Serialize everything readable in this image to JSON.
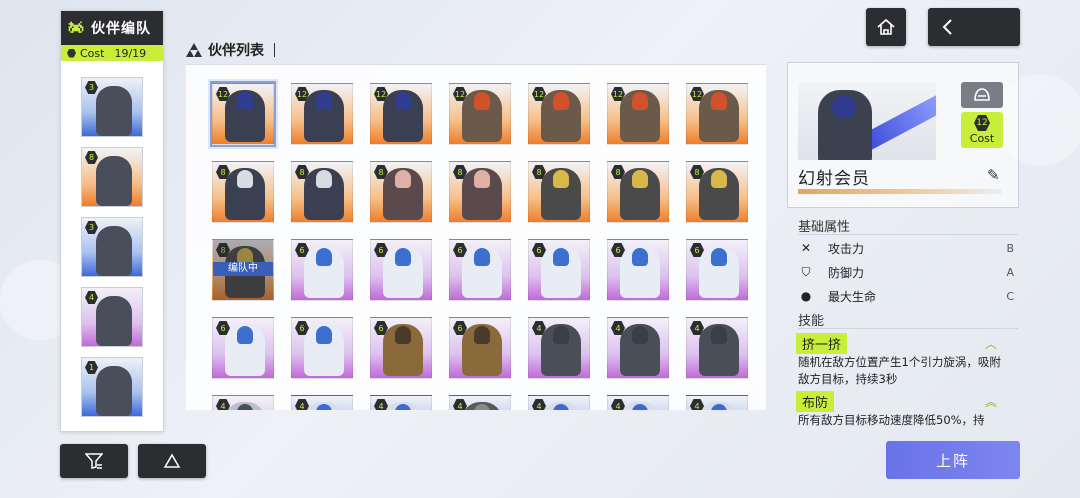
{
  "team": {
    "title": "伙伴编队",
    "cost_label": "Cost",
    "cost_value": "19/19",
    "members": [
      {
        "level": "3",
        "bg": "blue"
      },
      {
        "level": "8",
        "bg": "orange"
      },
      {
        "level": "3",
        "bg": "blue"
      },
      {
        "level": "4",
        "bg": "purple"
      },
      {
        "level": "1",
        "bg": "blue"
      }
    ]
  },
  "list": {
    "title": "伙伴列表",
    "cards": [
      {
        "level": "12",
        "bg": "orange",
        "tone": "#3b3f52",
        "head": "#2f3c8f",
        "selected": true
      },
      {
        "level": "12",
        "bg": "orange",
        "tone": "#3b3f52",
        "head": "#2f3c8f"
      },
      {
        "level": "12",
        "bg": "orange",
        "tone": "#3b3f52",
        "head": "#2f3c8f"
      },
      {
        "level": "12",
        "bg": "orange",
        "tone": "#6b5a4a",
        "head": "#d2502a"
      },
      {
        "level": "12",
        "bg": "orange",
        "tone": "#6b5a4a",
        "head": "#d2502a"
      },
      {
        "level": "12",
        "bg": "orange",
        "tone": "#6b5a4a",
        "head": "#d2502a"
      },
      {
        "level": "12",
        "bg": "orange",
        "tone": "#6b5a4a",
        "head": "#d2502a"
      },
      {
        "level": "8",
        "bg": "orange",
        "tone": "#3b3f52",
        "head": "#d9dbe2"
      },
      {
        "level": "8",
        "bg": "orange",
        "tone": "#3b3f52",
        "head": "#d9dbe2"
      },
      {
        "level": "8",
        "bg": "orange",
        "tone": "#5a4a4e",
        "head": "#e0b0a8"
      },
      {
        "level": "8",
        "bg": "orange",
        "tone": "#5a4a4e",
        "head": "#e0b0a8"
      },
      {
        "level": "8",
        "bg": "orange",
        "tone": "#4a4a4a",
        "head": "#d8b848"
      },
      {
        "level": "8",
        "bg": "orange",
        "tone": "#4a4a4a",
        "head": "#d8b848"
      },
      {
        "level": "8",
        "bg": "orange",
        "tone": "#4a4a4a",
        "head": "#d8b848"
      },
      {
        "level": "8",
        "bg": "orange",
        "tone": "#4a4a4a",
        "head": "#d8b848",
        "dim": true,
        "badge": "编队中"
      },
      {
        "level": "6",
        "bg": "purple",
        "tone": "#e8ecf4",
        "head": "#3c6fd0"
      },
      {
        "level": "6",
        "bg": "purple",
        "tone": "#e8ecf4",
        "head": "#3c6fd0"
      },
      {
        "level": "6",
        "bg": "purple",
        "tone": "#e8ecf4",
        "head": "#3c6fd0"
      },
      {
        "level": "6",
        "bg": "purple",
        "tone": "#e8ecf4",
        "head": "#3c6fd0"
      },
      {
        "level": "6",
        "bg": "purple",
        "tone": "#e8ecf4",
        "head": "#3c6fd0"
      },
      {
        "level": "6",
        "bg": "purple",
        "tone": "#e8ecf4",
        "head": "#3c6fd0"
      },
      {
        "level": "6",
        "bg": "purple",
        "tone": "#e8ecf4",
        "head": "#3c6fd0"
      },
      {
        "level": "6",
        "bg": "purple",
        "tone": "#e8ecf4",
        "head": "#3c6fd0"
      },
      {
        "level": "6",
        "bg": "purple",
        "tone": "#8a6a3a",
        "head": "#4a3a2a"
      },
      {
        "level": "6",
        "bg": "purple",
        "tone": "#8a6a3a",
        "head": "#4a3a2a"
      },
      {
        "level": "4",
        "bg": "purple",
        "tone": "#4a4e58",
        "head": "#3a3e48"
      },
      {
        "level": "4",
        "bg": "purple",
        "tone": "#4a4e58",
        "head": "#3a3e48"
      },
      {
        "level": "4",
        "bg": "purple",
        "tone": "#4a4e58",
        "head": "#3a3e48"
      },
      {
        "level": "4",
        "bg": "purple",
        "tone": "#b8c0cc",
        "head": "#4a4e58"
      },
      {
        "level": "4",
        "bg": "blue",
        "tone": "#d8dde6",
        "head": "#3e68d8"
      },
      {
        "level": "4",
        "bg": "blue",
        "tone": "#d8dde6",
        "head": "#3e68d8"
      },
      {
        "level": "4",
        "bg": "blue",
        "tone": "#5a5a5a",
        "head": "#8a8a8a"
      },
      {
        "level": "4",
        "bg": "blue",
        "tone": "#d8dde6",
        "head": "#3e68d8"
      },
      {
        "level": "4",
        "bg": "blue",
        "tone": "#d8dde6",
        "head": "#3e68d8"
      },
      {
        "level": "4",
        "bg": "blue",
        "tone": "#d8dde6",
        "head": "#3e68d8"
      }
    ]
  },
  "detail": {
    "name": "幻射会员",
    "cost_level": "12",
    "cost_label": "Cost",
    "base_attr_title": "基础属性",
    "attributes": [
      {
        "icon": "crossed-swords-icon",
        "glyph": "✕",
        "name": "攻击力",
        "grade": "B"
      },
      {
        "icon": "shield-icon",
        "glyph": "⛉",
        "name": "防御力",
        "grade": "A"
      },
      {
        "icon": "drop-icon",
        "glyph": "●",
        "name": "最大生命",
        "grade": "C"
      }
    ],
    "skills_title": "技能",
    "skills": [
      {
        "name": "挤一挤",
        "desc": "随机在敌方位置产生1个引力旋涡，吸附敌方目标，持续3秒"
      },
      {
        "name": "布防",
        "desc": "所有敌方目标移动速度降低50%，持"
      }
    ]
  },
  "buttons": {
    "deploy": "上阵"
  },
  "colors": {
    "accent_green": "#c7ef3a",
    "dark": "#2b2d31",
    "deploy": "#7078ec"
  }
}
